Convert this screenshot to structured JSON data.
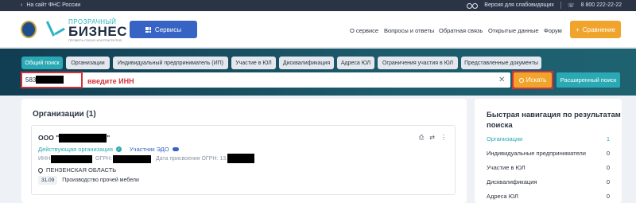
{
  "topbar": {
    "back_arrow": "‹",
    "back_link": "На сайт ФНС России",
    "accessibility": "Версия для слабовидящих",
    "phone_icon": "phone-icon",
    "phone": "8 800 222-22-22"
  },
  "header": {
    "logo_small": "ПРОЗРАЧНЫЙ",
    "logo_big": "БИЗНЕС",
    "logo_tagline": "ПРОВЕРЬ СВОИХ КОНТРАГЕНТОВ",
    "services_label": "Сервисы",
    "nav": [
      "О сервисе",
      "Вопросы и ответы",
      "Обратная связь",
      "Открытые данные",
      "Форум"
    ],
    "compare_label": "Сравнение",
    "compare_icon": "+"
  },
  "search": {
    "tabs": [
      "Общий поиск",
      "Организации",
      "Индивидуальный предприниматель (ИП)",
      "Участие в ЮЛ",
      "Дисквалификация",
      "Адреса ЮЛ",
      "Ограничения участия в ЮЛ",
      "Представленные документы"
    ],
    "active_tab": 0,
    "input_value": "583",
    "annotation": "введите ИНН",
    "clear_symbol": "✕",
    "search_button": "Искать",
    "advanced_button": "Расширенный поиск"
  },
  "results": {
    "title": "Организации (1)",
    "card": {
      "name_prefix": "ООО \"",
      "name_suffix": "\"",
      "status": "Действующая организация",
      "check_mark": "✓",
      "edo": "Участник ЭДО",
      "inn_label": "ИНН:",
      "ogrn_label": "ОГРН:",
      "ogrn_date_label": "Дата присвоения ОГРН: 13.",
      "region": "ПЕНЗЕНСКАЯ ОБЛАСТЬ",
      "okved_code": "31.09",
      "okved_name": "Производство прочей мебели",
      "actions": [
        "⎙",
        "⇄",
        "⋮"
      ]
    }
  },
  "sidenav": {
    "title": "Быстрая навигация по результатам поиска",
    "items": [
      {
        "label": "Организации",
        "count": "1"
      },
      {
        "label": "Индивидуальные предприниматели",
        "count": "0"
      },
      {
        "label": "Участие в ЮЛ",
        "count": "0"
      },
      {
        "label": "Дисквалификация",
        "count": "0"
      },
      {
        "label": "Адреса ЮЛ",
        "count": "0"
      }
    ]
  },
  "colors": {
    "accent_teal": "#2aa9b4",
    "accent_orange": "#f1a42b",
    "accent_blue": "#3663c4",
    "annotation_red": "#d3313a"
  }
}
